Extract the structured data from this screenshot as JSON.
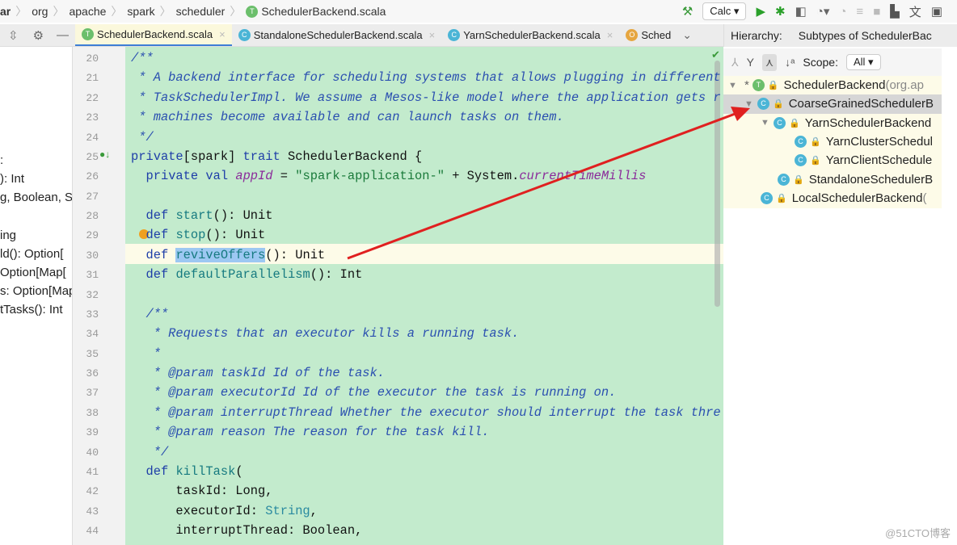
{
  "breadcrumb": [
    "ar",
    "org",
    "apache",
    "spark",
    "scheduler",
    "SchedulerBackend.scala"
  ],
  "toolbar": {
    "run_config": "Calc"
  },
  "tabs": [
    {
      "label": "SchedulerBackend.scala",
      "icon": "T",
      "active": true
    },
    {
      "label": "StandaloneSchedulerBackend.scala",
      "icon": "C"
    },
    {
      "label": "YarnSchedulerBackend.scala",
      "icon": "C"
    },
    {
      "label": "Sched",
      "icon": "O"
    }
  ],
  "hierarchy": {
    "label": "Hierarchy:",
    "title": "Subtypes of SchedulerBac",
    "scope_label": "Scope:",
    "scope_value": "All",
    "nodes": [
      {
        "label": "SchedulerBackend",
        "extra": " (org.ap",
        "icon": "T",
        "star": "*"
      },
      {
        "label": "CoarseGrainedSchedulerB",
        "icon": "C",
        "selected": true
      },
      {
        "label": "YarnSchedulerBackend",
        "icon": "C"
      },
      {
        "label": "YarnClusterSchedul",
        "icon": "C"
      },
      {
        "label": "YarnClientSchedule",
        "icon": "C"
      },
      {
        "label": "StandaloneSchedulerB",
        "icon": "C"
      },
      {
        "label": "LocalSchedulerBackend",
        "extra": " (",
        "icon": "C"
      }
    ]
  },
  "structure": [
    ":",
    "): Int",
    "g, Boolean, S",
    "",
    "ing",
    "ld(): Option[",
    "Option[Map[",
    "s: Option[Map",
    "tTasks(): Int"
  ],
  "line_numbers": [
    "20",
    "21",
    "22",
    "23",
    "24",
    "25",
    "26",
    "27",
    "28",
    "29",
    "30",
    "31",
    "32",
    "33",
    "34",
    "35",
    "36",
    "37",
    "38",
    "39",
    "40",
    "41",
    "42",
    "43",
    "44"
  ],
  "accent_color": "#e02020",
  "watermark": "@51CTO博客"
}
